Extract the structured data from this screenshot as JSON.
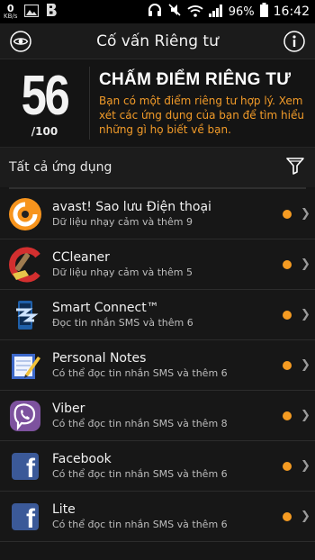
{
  "status_bar": {
    "kb_value": "0",
    "kb_unit": "KB/s",
    "battery": "96%",
    "time": "16:42",
    "icons": [
      "data-speed",
      "gallery-icon",
      "b-icon",
      "headset-icon",
      "mute-icon",
      "wifi-icon",
      "signal-icon",
      "battery-icon"
    ]
  },
  "header": {
    "title": "Cố vấn Riêng tư",
    "left_icon": "eye-icon",
    "right_icon": "info-icon"
  },
  "score": {
    "value": "56",
    "max": "/100",
    "title": "CHẤM ĐIỂM RIÊNG TƯ",
    "description": "Bạn có một điểm riêng tư hợp lý. Xem xét các ứng dụng của bạn để tìm hiểu những gì họ biết về bạn.",
    "desc_color": "#f29b29"
  },
  "filter": {
    "label": "Tất cả ứng dụng",
    "icon": "filter-icon"
  },
  "apps": [
    {
      "name": "avast! Sao lưu Điện thoại",
      "detail": "Dữ liệu nhạy cảm và thêm 9",
      "icon": "avast-icon",
      "risk_color": "#f59b22"
    },
    {
      "name": "CCleaner",
      "detail": "Dữ liệu nhạy cảm và thêm 5",
      "icon": "ccleaner-icon",
      "risk_color": "#f59b22"
    },
    {
      "name": "Smart Connect™",
      "detail": "Đọc tin nhắn SMS và thêm 6",
      "icon": "smart-connect-icon",
      "risk_color": "#f59b22"
    },
    {
      "name": "Personal Notes",
      "detail": "Có thể đọc tin nhắn SMS và thêm 6",
      "icon": "notes-icon",
      "risk_color": "#f59b22"
    },
    {
      "name": "Viber",
      "detail": "Có thể đọc tin nhắn SMS và thêm 8",
      "icon": "viber-icon",
      "risk_color": "#f59b22"
    },
    {
      "name": "Facebook",
      "detail": "Có thể đọc tin nhắn SMS và thêm 6",
      "icon": "facebook-icon",
      "risk_color": "#f59b22"
    },
    {
      "name": "Lite",
      "detail": "Có thể đọc tin nhắn SMS và thêm 6",
      "icon": "facebook-lite-icon",
      "risk_color": "#f59b22"
    }
  ]
}
